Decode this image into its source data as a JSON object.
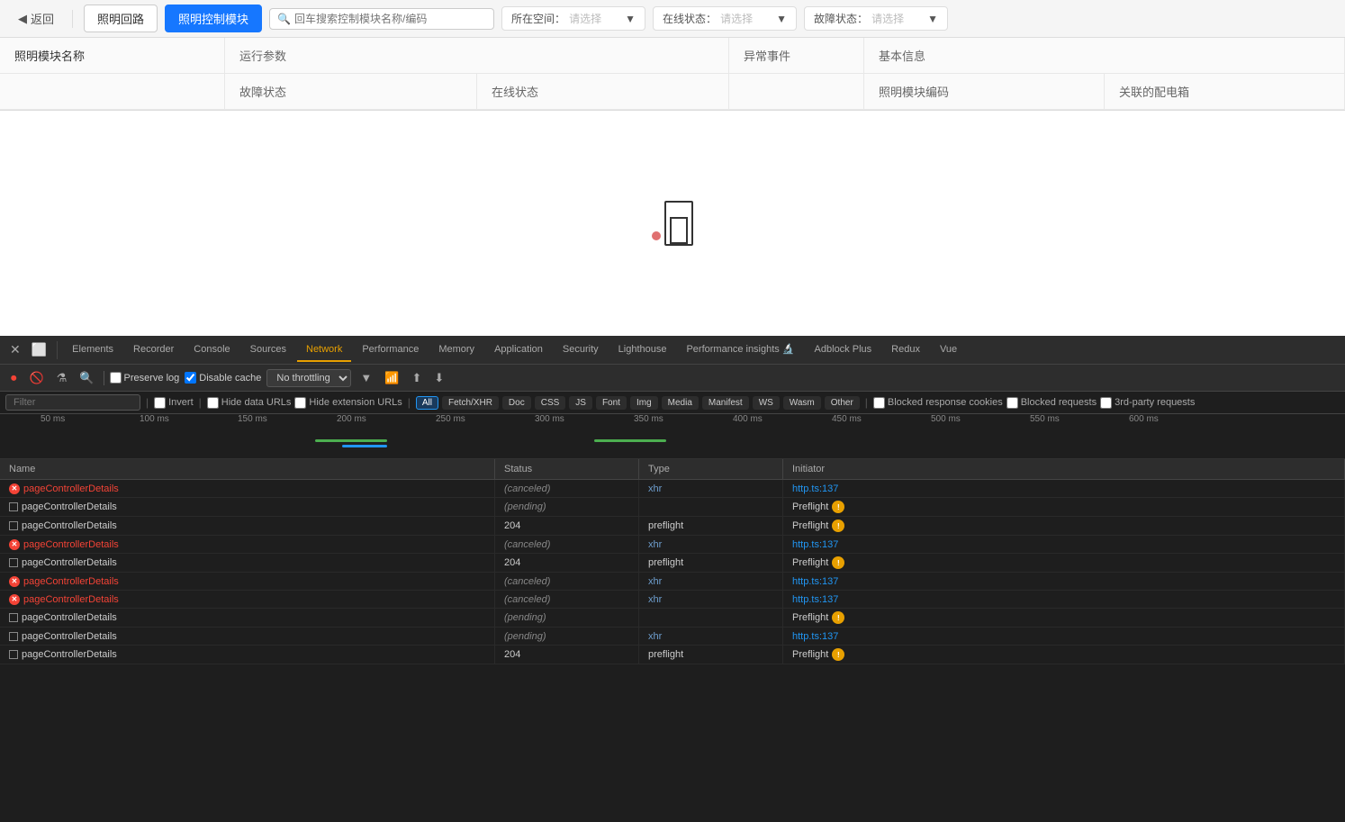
{
  "topbar": {
    "back_label": "返回",
    "tab1_label": "照明回路",
    "tab2_label": "照明控制模块",
    "search_placeholder": "回车搜索控制模块名称/编码",
    "filter1_label": "所在空间：",
    "filter1_placeholder": "请选择",
    "filter2_label": "在线状态：",
    "filter2_placeholder": "请选择",
    "filter3_label": "故障状态：",
    "filter3_placeholder": "请选择"
  },
  "table": {
    "col1": "照明模块名称",
    "col2_header": "运行参数",
    "col2_sub1": "故障状态",
    "col2_sub2": "在线状态",
    "col3": "异常事件",
    "col4_header": "基本信息",
    "col4_sub1": "照明模块编码",
    "col4_sub2": "关联的配电箱"
  },
  "devtools": {
    "tabs": [
      {
        "label": "Elements",
        "active": false
      },
      {
        "label": "Recorder",
        "active": false
      },
      {
        "label": "Console",
        "active": false
      },
      {
        "label": "Sources",
        "active": false
      },
      {
        "label": "Network",
        "active": true
      },
      {
        "label": "Performance",
        "active": false
      },
      {
        "label": "Memory",
        "active": false
      },
      {
        "label": "Application",
        "active": false
      },
      {
        "label": "Security",
        "active": false
      },
      {
        "label": "Lighthouse",
        "active": false
      },
      {
        "label": "Performance insights",
        "active": false
      },
      {
        "label": "Adblock Plus",
        "active": false
      },
      {
        "label": "Redux",
        "active": false
      },
      {
        "label": "Vue",
        "active": false
      }
    ],
    "toolbar": {
      "preserve_log": "Preserve log",
      "disable_cache": "Disable cache",
      "throttle_label": "No throttling"
    },
    "filter_bar": {
      "placeholder": "Filter",
      "invert": "Invert",
      "hide_data_urls": "Hide data URLs",
      "hide_ext_urls": "Hide extension URLs",
      "type_buttons": [
        "All",
        "Fetch/XHR",
        "Doc",
        "CSS",
        "JS",
        "Font",
        "Img",
        "Media",
        "Manifest",
        "WS",
        "Wasm",
        "Other"
      ],
      "blocked_cookies": "Blocked response cookies",
      "blocked_requests": "Blocked requests",
      "third_party": "3rd-party requests"
    },
    "timeline": {
      "labels": [
        "50 ms",
        "100 ms",
        "150 ms",
        "200 ms",
        "250 ms",
        "300 ms",
        "350 ms",
        "400 ms",
        "450 ms",
        "500 ms",
        "550 ms",
        "600 ms"
      ],
      "label_positions": [
        55,
        165,
        275,
        385,
        495,
        605,
        715,
        825,
        935,
        1045,
        1155,
        1265
      ]
    },
    "table": {
      "headers": [
        "Name",
        "Status",
        "Type",
        "Initiator"
      ],
      "rows": [
        {
          "icon": "x",
          "name": "pageControllerDetails",
          "status": "(canceled)",
          "status_type": "canceled",
          "type": "xhr",
          "type_color": "blue",
          "initiator": "http.ts:137",
          "initiator_type": "link"
        },
        {
          "icon": "sq",
          "name": "pageControllerDetails",
          "status": "(pending)",
          "status_type": "pending",
          "type": "",
          "type_color": "",
          "initiator": "Preflight",
          "initiator_type": "preflight"
        },
        {
          "icon": "sq",
          "name": "pageControllerDetails",
          "status": "204",
          "status_type": "ok",
          "type": "preflight",
          "type_color": "normal",
          "initiator": "Preflight",
          "initiator_type": "preflight"
        },
        {
          "icon": "x",
          "name": "pageControllerDetails",
          "status": "(canceled)",
          "status_type": "canceled",
          "type": "xhr",
          "type_color": "blue",
          "initiator": "http.ts:137",
          "initiator_type": "link"
        },
        {
          "icon": "sq",
          "name": "pageControllerDetails",
          "status": "204",
          "status_type": "ok",
          "type": "preflight",
          "type_color": "normal",
          "initiator": "Preflight",
          "initiator_type": "preflight"
        },
        {
          "icon": "x",
          "name": "pageControllerDetails",
          "status": "(canceled)",
          "status_type": "canceled",
          "type": "xhr",
          "type_color": "blue",
          "initiator": "http.ts:137",
          "initiator_type": "link"
        },
        {
          "icon": "x",
          "name": "pageControllerDetails",
          "status": "(canceled)",
          "status_type": "canceled",
          "type": "xhr",
          "type_color": "blue",
          "initiator": "http.ts:137",
          "initiator_type": "link"
        },
        {
          "icon": "sq",
          "name": "pageControllerDetails",
          "status": "(pending)",
          "status_type": "pending",
          "type": "",
          "type_color": "",
          "initiator": "Preflight",
          "initiator_type": "preflight"
        },
        {
          "icon": "sq",
          "name": "pageControllerDetails",
          "status": "(pending)",
          "status_type": "pending",
          "type": "xhr",
          "type_color": "blue",
          "initiator": "http.ts:137",
          "initiator_type": "link"
        },
        {
          "icon": "sq",
          "name": "pageControllerDetails",
          "status": "204",
          "status_type": "ok",
          "type": "preflight",
          "type_color": "normal",
          "initiator": "Preflight",
          "initiator_type": "preflight"
        }
      ]
    }
  }
}
